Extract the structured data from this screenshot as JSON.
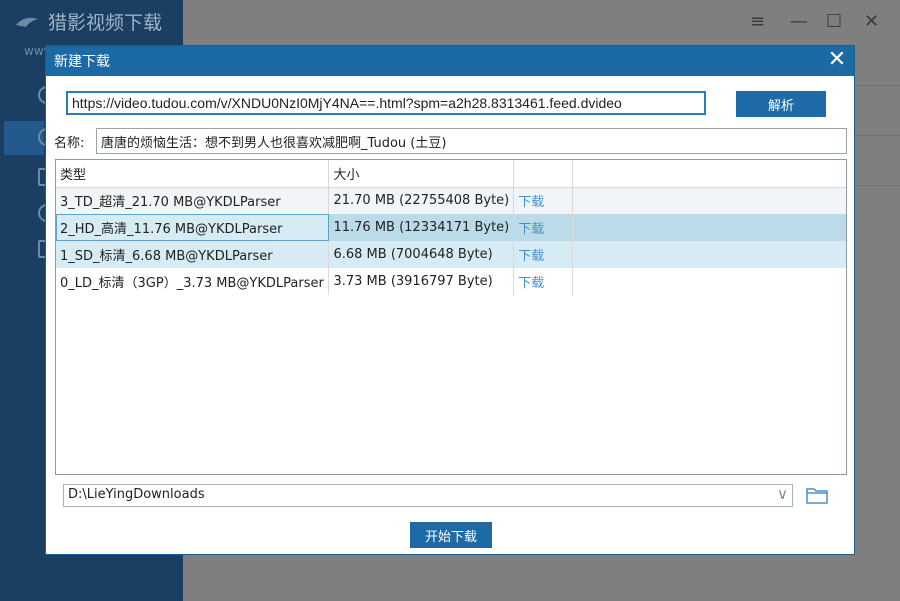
{
  "app": {
    "title": "猎影视频下载",
    "www": "www"
  },
  "dialog": {
    "title": "新建下载",
    "url_value": "https://video.tudou.com/v/XNDU0NzI0MjY4NA==.html?spm=a2h28.8313461.feed.dvideo",
    "parse_label": "解析",
    "name_label": "名称:",
    "name_value": "唐唐的烦恼生活：想不到男人也很喜欢减肥啊_Tudou (土豆)",
    "columns": [
      "类型",
      "大小"
    ],
    "rows": [
      {
        "type": "3_TD_超清_21.70 MB@YKDLParser",
        "size": "21.70 MB (22755408 Byte)",
        "action": "下载"
      },
      {
        "type": "2_HD_高清_11.76 MB@YKDLParser",
        "size": "11.76 MB (12334171 Byte)",
        "action": "下载"
      },
      {
        "type": "1_SD_标清_6.68 MB@YKDLParser",
        "size": "6.68 MB (7004648 Byte)",
        "action": "下载"
      },
      {
        "type": "0_LD_标清（3GP）_3.73 MB@YKDLParser",
        "size": "3.73 MB (3916797 Byte)",
        "action": "下载"
      }
    ],
    "path_value": "D:\\LieYingDownloads",
    "start_label": "开始下载"
  },
  "colors": {
    "title_bar": "#1c6aa3",
    "button": "#1d6aa6",
    "selected_row": "#bcdbe8",
    "link": "#4a90c8"
  }
}
